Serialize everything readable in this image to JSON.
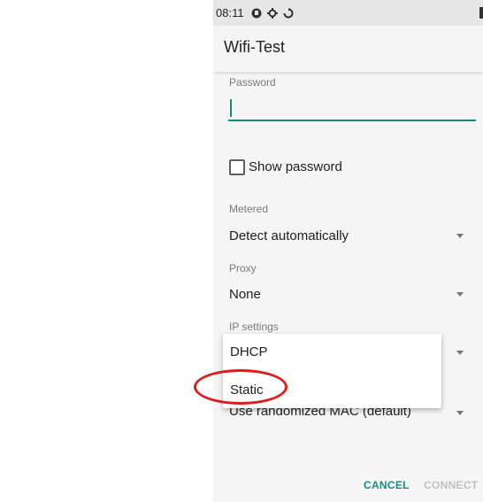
{
  "status_bar": {
    "time": "08:11",
    "icons": [
      "notification-icon",
      "gear-icon",
      "sync-icon",
      "battery-icon"
    ]
  },
  "dialog": {
    "title": "Wifi-Test",
    "password": {
      "label": "Password",
      "value": ""
    },
    "show_password": {
      "label": "Show password",
      "checked": false
    },
    "metered": {
      "label": "Metered",
      "value": "Detect automatically"
    },
    "proxy": {
      "label": "Proxy",
      "value": "None"
    },
    "ip_settings": {
      "label": "IP settings"
    },
    "privacy": {
      "value": "Use randomized MAC (default)"
    },
    "ip_options": [
      "DHCP",
      "Static"
    ],
    "actions": {
      "cancel": "CANCEL",
      "connect": "CONNECT"
    }
  },
  "colors": {
    "accent": "#1a8a7d",
    "annotation": "#e01b1b",
    "disabled": "#c0c0c0"
  }
}
